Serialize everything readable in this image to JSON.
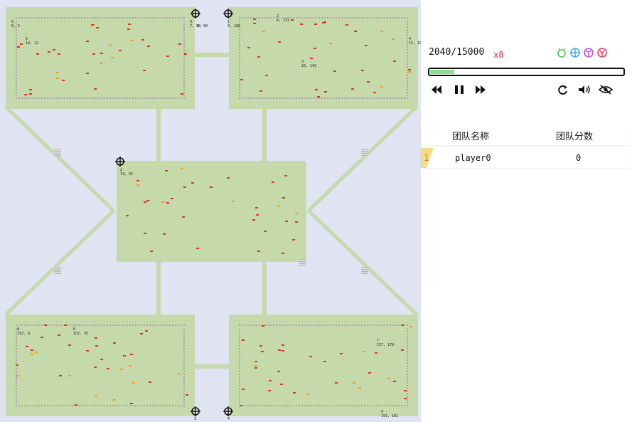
{
  "status": {
    "frame": "2040/15000",
    "speed": "x8",
    "progress": 0.125
  },
  "controls": [
    "rewind-icon",
    "pause-icon",
    "fast-forward-icon",
    "refresh-icon",
    "volume-icon",
    "eye-slash-icon"
  ],
  "teams_icons": [
    {
      "name": "team-icon-green",
      "color": "#4cc94c"
    },
    {
      "name": "team-icon-blue",
      "color": "#4aa8e8"
    },
    {
      "name": "team-icon-purple",
      "color": "#c050e0"
    },
    {
      "name": "team-icon-red",
      "color": "#e04060"
    }
  ],
  "scoreboard": {
    "header_team": "团队名称",
    "header_score": "团队分数",
    "rows": [
      {
        "rank": "1",
        "team": "player0",
        "score": "0"
      }
    ]
  },
  "map": {
    "labels": [
      {
        "text": "0\n6, 5"
      },
      {
        "text": "5\n14, 12"
      },
      {
        "text": "0\n7, 90"
      },
      {
        "text": "4, 90"
      },
      {
        "text": "1\n4, 186"
      },
      {
        "text": "2\n4, 131"
      },
      {
        "text": "3\n25, 143"
      },
      {
        "text": "4\n15, 194"
      },
      {
        "text": "2\n74, 55"
      },
      {
        "text": "8\n152, 8"
      },
      {
        "text": "6\n152, 35"
      },
      {
        "text": "7\n157, 179"
      },
      {
        "text": "9\n191, 181"
      },
      {
        "text": "3"
      },
      {
        "text": "4"
      }
    ]
  }
}
